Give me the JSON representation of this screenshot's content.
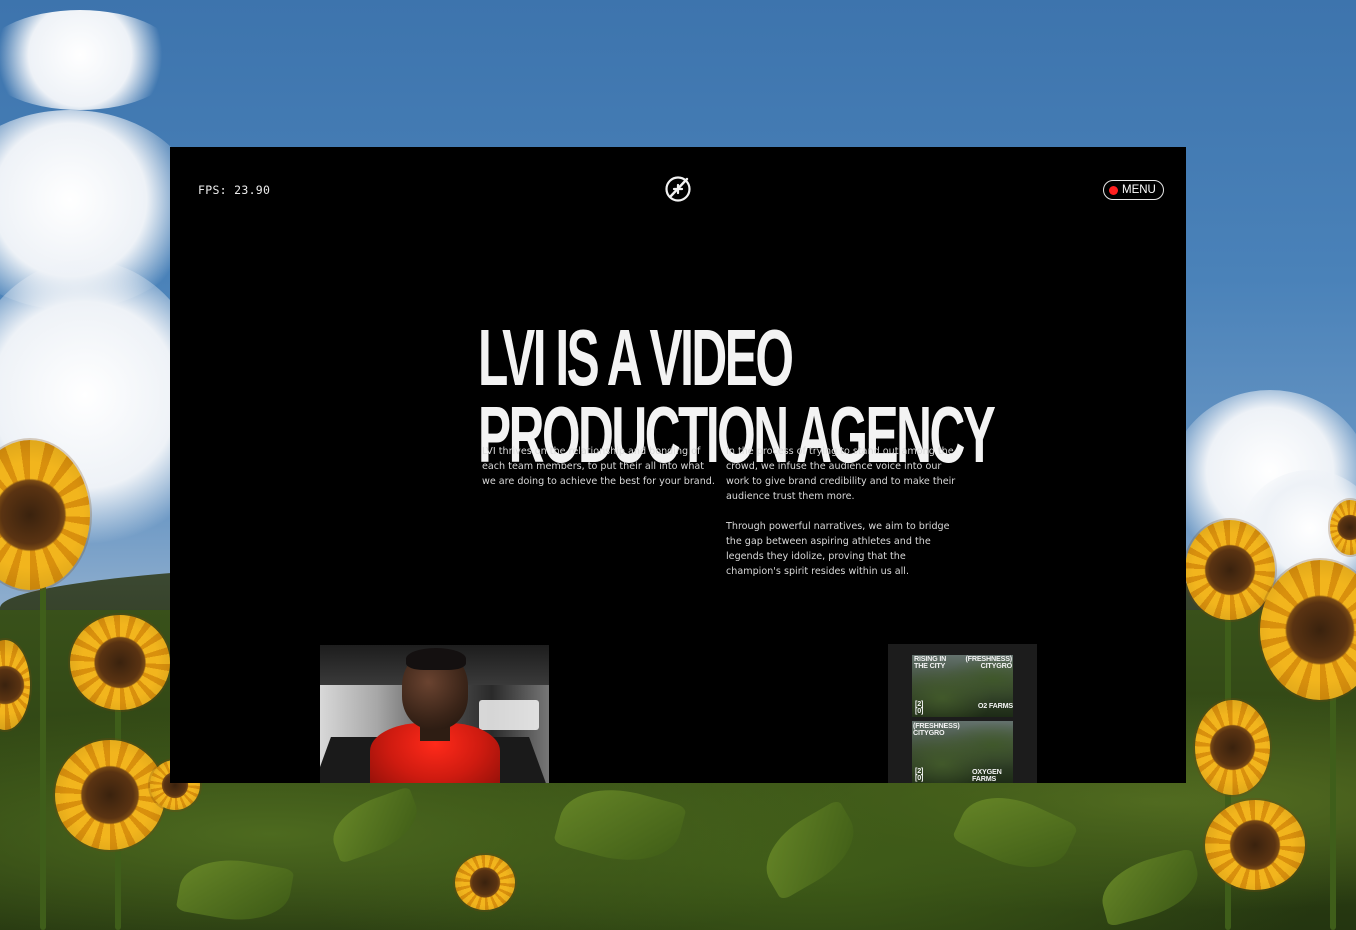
{
  "window": {
    "fps_label": "FPS: 23.90",
    "menu_label": "MENU"
  },
  "hero": {
    "headline_line1": "LVI IS A VIDEO",
    "headline_line2": "PRODUCTION AGENCY",
    "left_paragraph": "LVI thrives on the relationship and bonding of each team members, to put their all into what we are doing to achieve the best for your brand.",
    "right_paragraph_1": "In the process of trying to stand out among the crowd, we infuse the audience voice into our work to give brand credibility and to make their audience trust them more.",
    "right_paragraph_2": "Through powerful narratives, we aim to bridge the gap between aspiring athletes and the legends they idolize, proving that the champion's spirit resides within us all."
  },
  "collage": {
    "card1": {
      "tl": "RISING IN THE CITY",
      "tr": "(FRESHNESS) CITYGRO",
      "bl": "[2] [0]",
      "br": "O2 FARMS"
    },
    "card2": {
      "tl": "(FRESHNESS) CITYGRO",
      "bl": "[2] [0]",
      "br": "OXYGEN FARMS"
    }
  },
  "colors": {
    "window_bg": "#000000",
    "menu_dot": "#ff1f1f",
    "text": "#f3f3f3"
  },
  "icons": {
    "logo": "crossed-circle-logo-icon",
    "menu_dot": "record-dot-icon"
  }
}
